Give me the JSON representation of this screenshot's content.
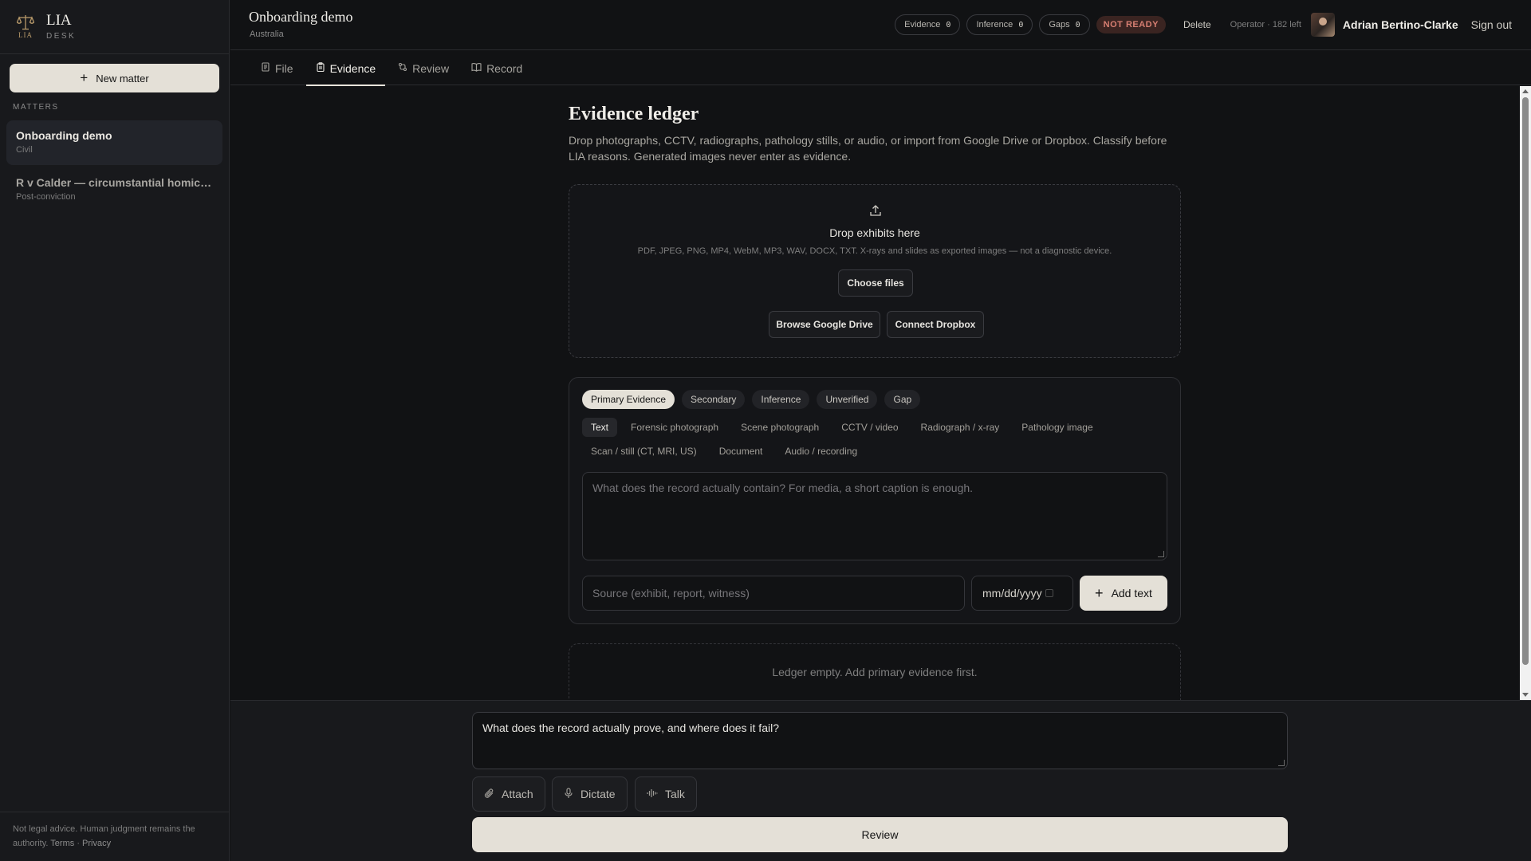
{
  "brand": {
    "name": "LIA",
    "sub": "DESK",
    "icon_letters": "LIA"
  },
  "sidebar": {
    "new_matter_label": "New matter",
    "matters_label": "MATTERS",
    "matters": [
      {
        "title": "Onboarding demo",
        "tag": "Civil"
      },
      {
        "title": "R v Calder — circumstantial homicide",
        "tag": "Post-conviction"
      }
    ],
    "footer_text": "Not legal advice. Human judgment remains the authority.",
    "footer_terms": "Terms",
    "footer_sep": "·",
    "footer_privacy": "Privacy"
  },
  "header": {
    "title": "Onboarding demo",
    "subtitle": "Australia",
    "pills": [
      {
        "label": "Evidence",
        "count": "0"
      },
      {
        "label": "Inference",
        "count": "0"
      },
      {
        "label": "Gaps",
        "count": "0"
      }
    ],
    "status_badge": "NOT READY",
    "delete_label": "Delete",
    "operator_text": "Operator · 182 left",
    "user_name": "Adrian Bertino-Clarke",
    "signout_label": "Sign out"
  },
  "tabs": [
    {
      "label": "File",
      "icon": "file-icon"
    },
    {
      "label": "Evidence",
      "icon": "clipboard-icon"
    },
    {
      "label": "Review",
      "icon": "review-icon"
    },
    {
      "label": "Record",
      "icon": "book-icon"
    }
  ],
  "ledger": {
    "title": "Evidence ledger",
    "description": "Drop photographs, CCTV, radiographs, pathology stills, or audio, or import from Google Drive or Dropbox. Classify before LIA reasons. Generated images never enter as evidence.",
    "dropzone": {
      "title": "Drop exhibits here",
      "subtitle": "PDF, JPEG, PNG, MP4, WebM, MP3, WAV, DOCX, TXT. X-rays and slides as exported images — not a diagnostic device.",
      "choose_files": "Choose files",
      "google_drive": "Browse Google Drive",
      "dropbox": "Connect Dropbox"
    },
    "classes": [
      "Primary Evidence",
      "Secondary",
      "Inference",
      "Unverified",
      "Gap"
    ],
    "selected_class": "Primary Evidence",
    "types": [
      "Text",
      "Forensic photograph",
      "Scene photograph",
      "CCTV / video",
      "Radiograph / x-ray",
      "Pathology image",
      "Scan / still (CT, MRI, US)",
      "Document",
      "Audio / recording"
    ],
    "selected_type": "Text",
    "content_placeholder": "What does the record actually contain? For media, a short caption is enough.",
    "source_placeholder": "Source (exhibit, report, witness)",
    "date_placeholder": "mm/dd/yyyy",
    "add_label": "Add text",
    "empty_text": "Ledger empty. Add primary evidence first."
  },
  "composer": {
    "prompt_value": "What does the record actually prove, and where does it fail?",
    "attach_label": "Attach",
    "dictate_label": "Dictate",
    "talk_label": "Talk",
    "review_label": "Review"
  },
  "colors": {
    "accent": "#e4e0d7",
    "background": "#111214",
    "sidebar": "#18191c",
    "status_red": "#d77f72"
  }
}
